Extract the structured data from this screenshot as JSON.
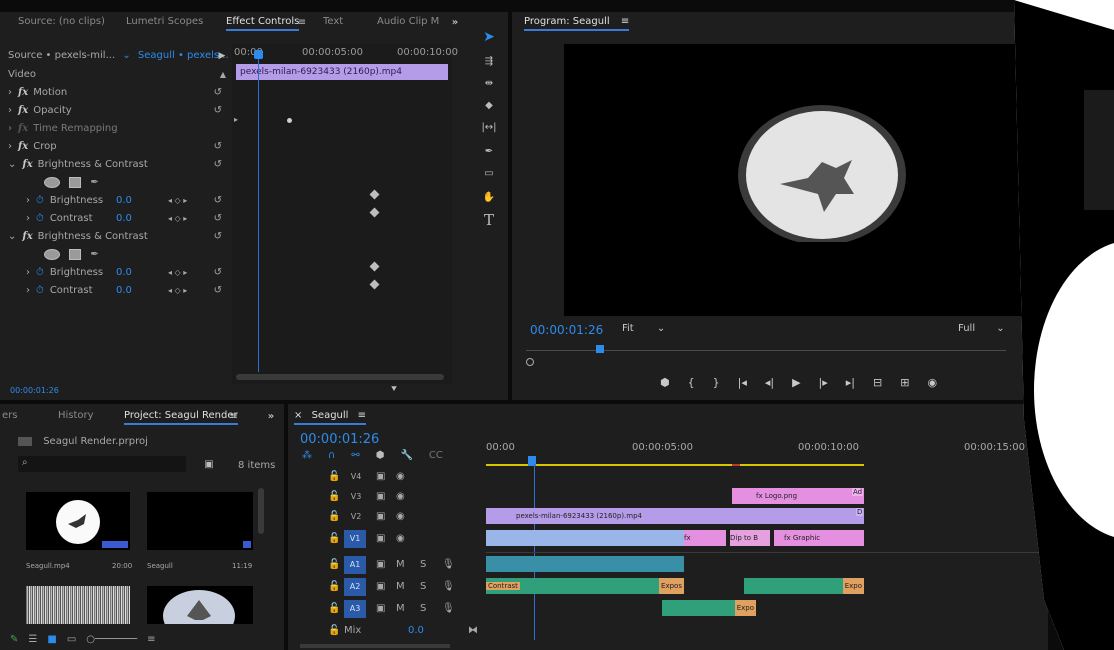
{
  "effect_controls": {
    "tabs": [
      "Source: (no clips)",
      "Lumetri Scopes",
      "Effect Controls",
      "Text",
      "Audio Clip M"
    ],
    "source_label": "Source • pexels-mil...",
    "sequence_label": "Seagull • pexels...",
    "section_video": "Video",
    "ruler": [
      "00:00",
      "00:00:05:00",
      "00:00:10:00"
    ],
    "clip_name": "pexels-milan-6923433 (2160p).mp4",
    "effects": {
      "motion": "Motion",
      "opacity": "Opacity",
      "time_remap": "Time Remapping",
      "crop": "Crop",
      "bc1": "Brightness & Contrast",
      "bc2": "Brightness & Contrast"
    },
    "params": {
      "brightness1_label": "Brightness",
      "brightness1_value": "0.0",
      "contrast1_label": "Contrast",
      "contrast1_value": "0.0",
      "brightness2_label": "Brightness",
      "brightness2_value": "0.0",
      "contrast2_label": "Contrast",
      "contrast2_value": "0.0"
    },
    "timecode": "00:00:01:26"
  },
  "program": {
    "title": "Program: Seagull",
    "timecode": "00:00:01:26",
    "fit": "Fit",
    "quality": "Full"
  },
  "project": {
    "tabs": [
      "ers",
      "History",
      "Project: Seagul Render"
    ],
    "file": "Seagul Render.prproj",
    "item_count": "8 items",
    "items": [
      {
        "name": "Seagull.mp4",
        "duration": "20:00"
      },
      {
        "name": "Seagull",
        "duration": "11:19"
      }
    ]
  },
  "timeline": {
    "tab": "Seagull",
    "timecode": "00:00:01:26",
    "ruler": [
      "00:00",
      "00:00:05:00",
      "00:00:10:00",
      "00:00:15:00"
    ],
    "video_tracks": [
      "V4",
      "V3",
      "V2",
      "V1"
    ],
    "audio_tracks": [
      "A1",
      "A2",
      "A3"
    ],
    "mix_label": "Mix",
    "mix_value": "0.0",
    "clips": {
      "logo": "Logo.png",
      "v2_clip": "pexels-milan-6923433 (2160p).mp4",
      "graphic": "Graphic",
      "dip": "Dip to B",
      "contrast": "Contrast",
      "expo1": "Expos",
      "expo2": "Expo",
      "expo3": "Expo",
      "ad": "Ad",
      "d": "D"
    }
  }
}
